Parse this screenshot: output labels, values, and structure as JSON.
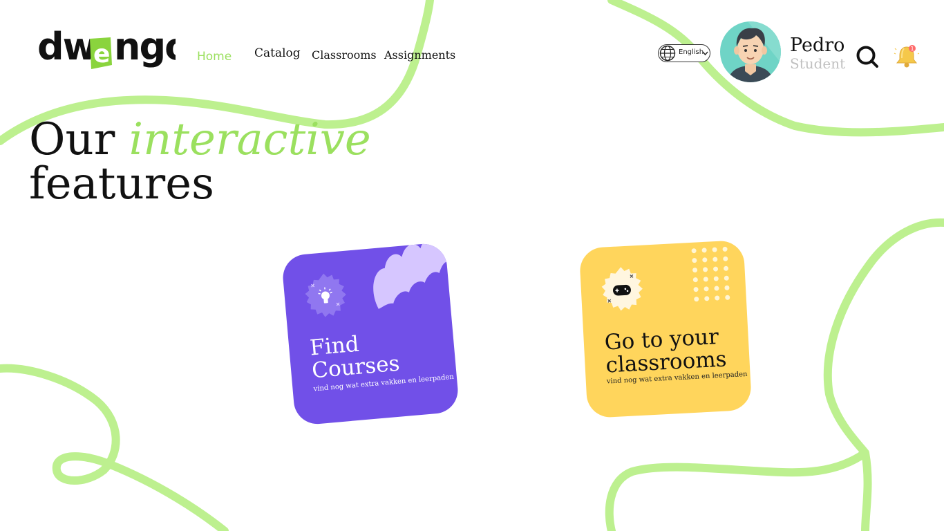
{
  "logo": {
    "text": "dwengo"
  },
  "nav": {
    "items": [
      {
        "label": "Home",
        "active": true
      },
      {
        "label": "Catalog",
        "active": false
      },
      {
        "label": "Classrooms",
        "active": false
      },
      {
        "label": "Assignments",
        "active": false
      }
    ]
  },
  "language": {
    "selected": "English",
    "icon": "globe-icon"
  },
  "user": {
    "name": "Pedro",
    "role": "Student",
    "notification_count": "1"
  },
  "headline": {
    "word1": "Our",
    "accent": "interactive",
    "word2": "features"
  },
  "cards": [
    {
      "title_line1": "Find",
      "title_line2": "Courses",
      "description": "vind nog wat extra vakken en leerpaden",
      "icon": "lightbulb-icon",
      "color": "#7150e8"
    },
    {
      "title_line1": "Go to your",
      "title_line2": "classrooms",
      "description": "vind nog wat extra vakken en leerpaden",
      "icon": "gamepad-icon",
      "color": "#ffd55c"
    }
  ],
  "colors": {
    "accent_green": "#9be05f",
    "squiggle_green": "#bdf08f",
    "bell_yellow": "#f5c84a",
    "badge_red": "#ff6b6b",
    "muted_text": "#c0c0c0"
  }
}
